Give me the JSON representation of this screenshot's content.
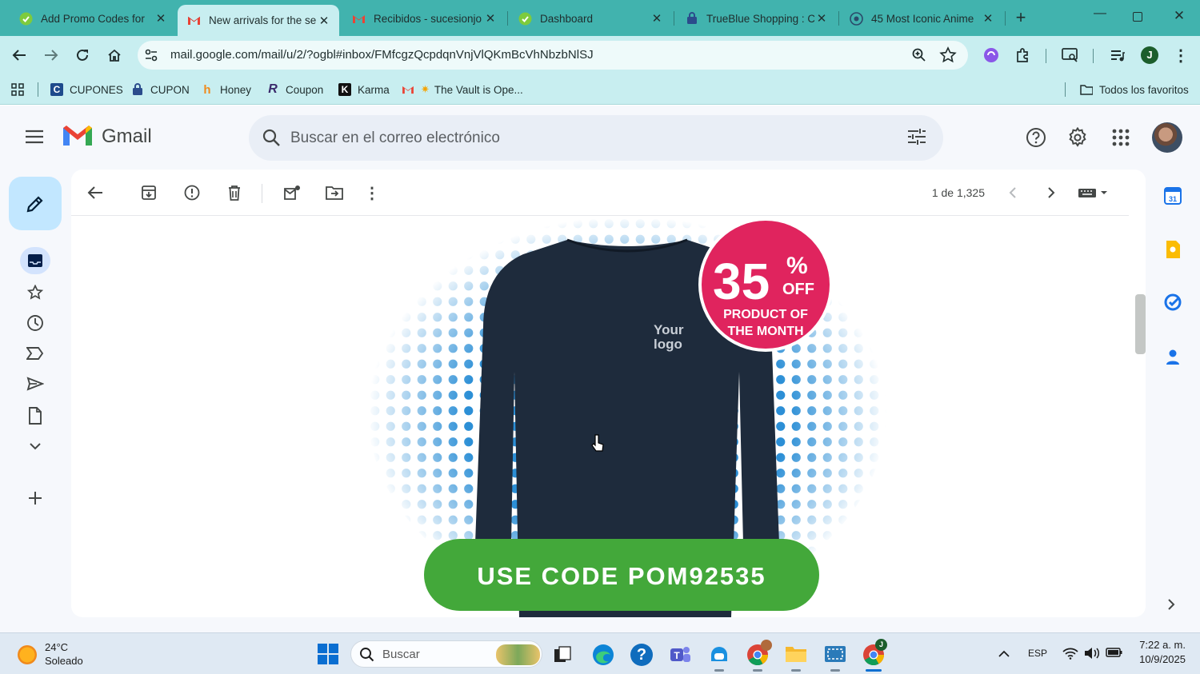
{
  "browser": {
    "tabs": [
      {
        "title": "Add Promo Codes for",
        "icon": "promo-icon"
      },
      {
        "title": "New arrivals for the se",
        "icon": "gmail-icon"
      },
      {
        "title": "Recibidos - sucesionjo",
        "icon": "gmail-icon"
      },
      {
        "title": "Dashboard",
        "icon": "promo-icon"
      },
      {
        "title": "TrueBlue Shopping : C",
        "icon": "lock-icon"
      },
      {
        "title": "45 Most Iconic Anime",
        "icon": "globe-icon"
      }
    ],
    "new_tab": "+",
    "url": "mail.google.com/mail/u/2/?ogbl#inbox/FMfcgzQcpdqnVnjVlQKmBcVhNbzbNlSJ",
    "profile_initial": "J",
    "bookmarks": [
      {
        "label": "CUPONES",
        "icon": "cupones-icon"
      },
      {
        "label": "CUPON",
        "icon": "cupon-icon"
      },
      {
        "label": "Honey",
        "icon": "honey-icon"
      },
      {
        "label": "Coupon",
        "icon": "coupon-icon"
      },
      {
        "label": "Karma",
        "icon": "karma-icon"
      },
      {
        "label": "The Vault is Ope...",
        "icon": "gmail-icon"
      }
    ],
    "all_favorites": "Todos los favoritos"
  },
  "gmail": {
    "logo_text": "Gmail",
    "search_placeholder": "Buscar en el correo electrónico",
    "pagination": "1 de 1,325",
    "email": {
      "badge_percent": "35",
      "badge_symbol": "%",
      "badge_off": "OFF",
      "badge_line1": "PRODUCT OF",
      "badge_line2": "THE MONTH",
      "logo_line1": "Your",
      "logo_line2": "logo",
      "code_button": "USE CODE POM92535"
    }
  },
  "taskbar": {
    "weather_temp": "24°C",
    "weather_desc": "Soleado",
    "search_label": "Buscar",
    "language": "ESP",
    "time": "7:22 a. m.",
    "date": "10/9/2025",
    "chrome_badge": "J"
  },
  "colors": {
    "tab_strip": "#41b3ae",
    "toolbar": "#c8eef0",
    "badge": "#e0245e",
    "code_button": "#43a83a",
    "sweater": "#1e2b3c",
    "dots": "#2c8fd6"
  }
}
